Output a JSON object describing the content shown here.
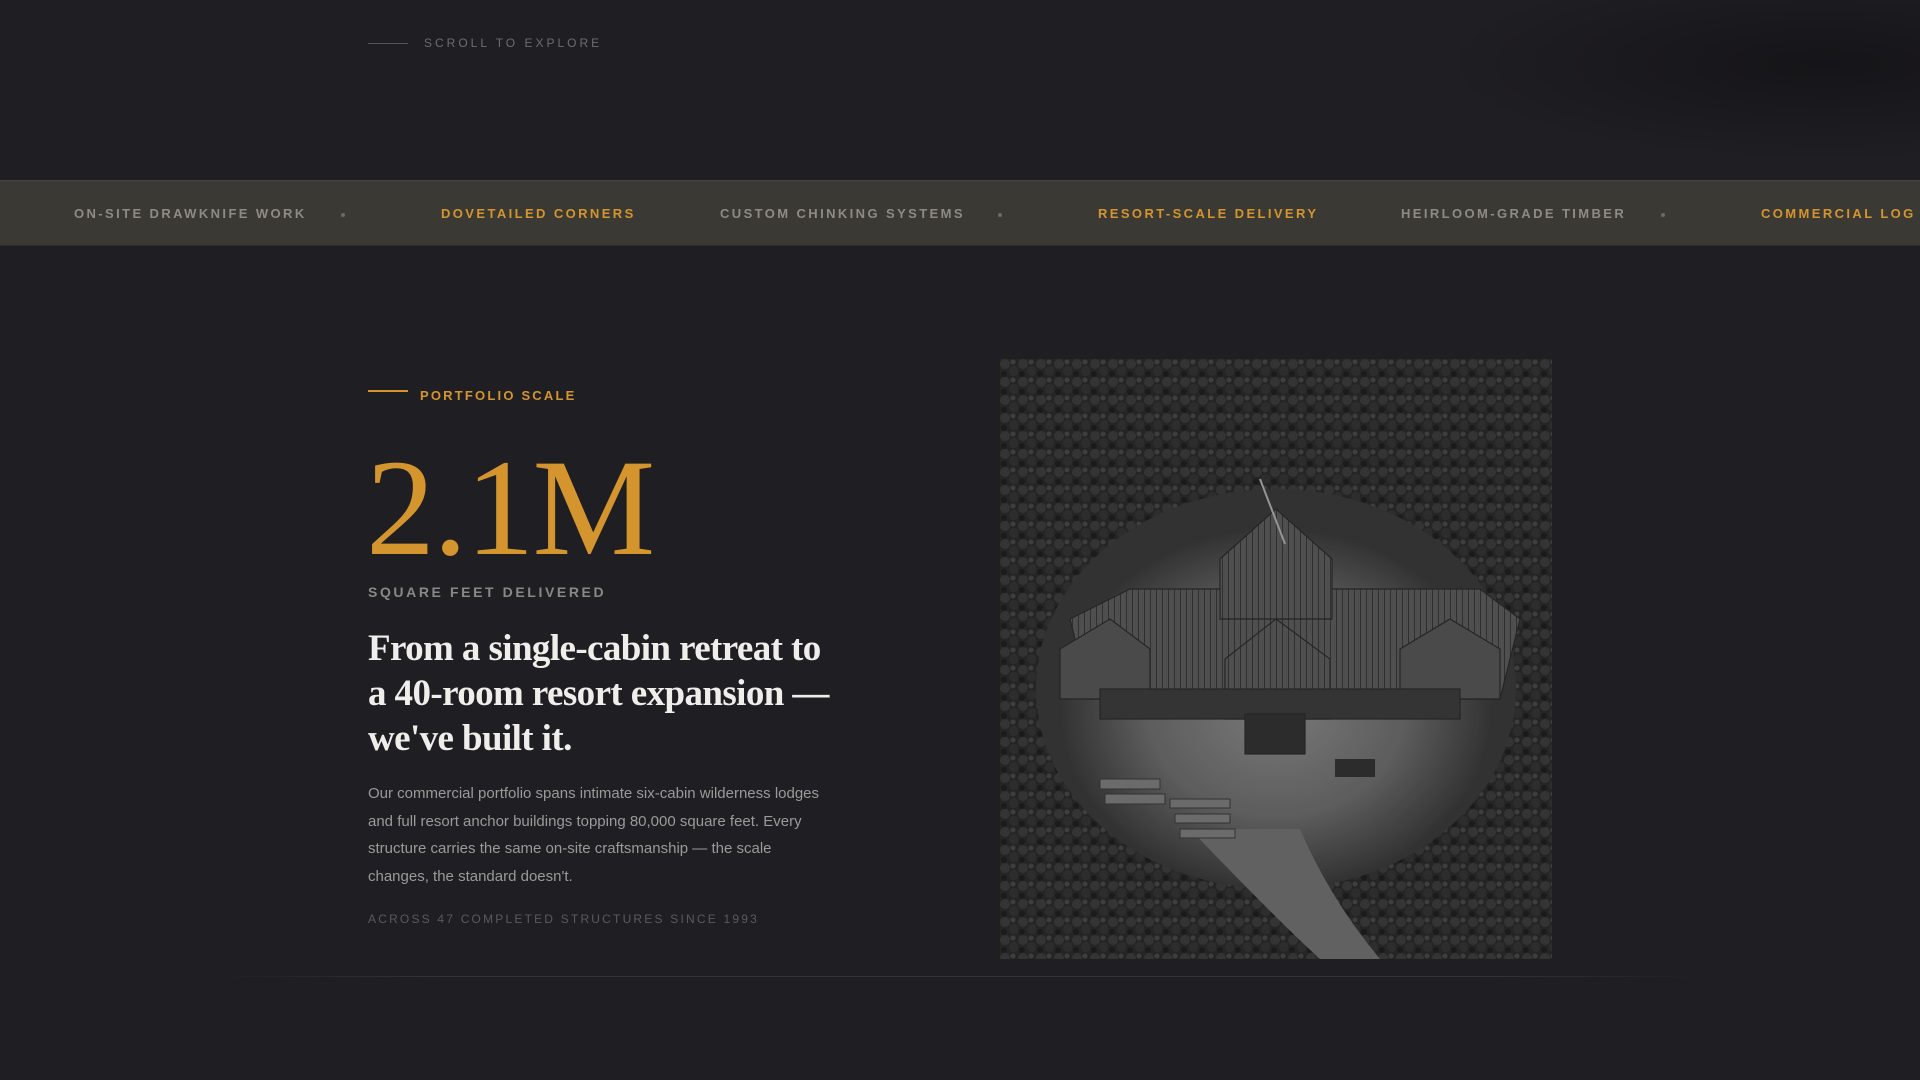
{
  "scroll_hint": {
    "text": "SCROLL TO EXPLORE"
  },
  "marquee": {
    "items": [
      {
        "label": "ON-SITE DRAWKNIFE WORK",
        "accent": false
      },
      {
        "label": "DOVETAILED CORNERS",
        "accent": true
      },
      {
        "label": "CUSTOM CHINKING SYSTEMS",
        "accent": false
      },
      {
        "label": "RESORT-SCALE DELIVERY",
        "accent": true
      },
      {
        "label": "HEIRLOOM-GRADE TIMBER",
        "accent": false
      },
      {
        "label": "COMMERCIAL LOG P",
        "accent": true
      }
    ]
  },
  "section": {
    "eyebrow": "PORTFOLIO SCALE",
    "stat_value": "2.1M",
    "stat_label": "SQUARE FEET DELIVERED",
    "headline": "From a single-cabin retreat to a 40-room resort expansion — we've built it.",
    "body": "Our commercial portfolio spans intimate six-cabin wilderness lodges and full resort anchor buildings topping 80,000 square feet. Every structure carries the same on-site craftsmanship — the scale changes, the standard doesn't.",
    "footnote": "ACROSS 47 COMPLETED STRUCTURES SINCE 1993"
  },
  "colors": {
    "background": "#1f1e23",
    "band": "#3a3934",
    "accent": "#d4952f",
    "headline": "#f0eeea",
    "muted": "#9c9a96"
  }
}
